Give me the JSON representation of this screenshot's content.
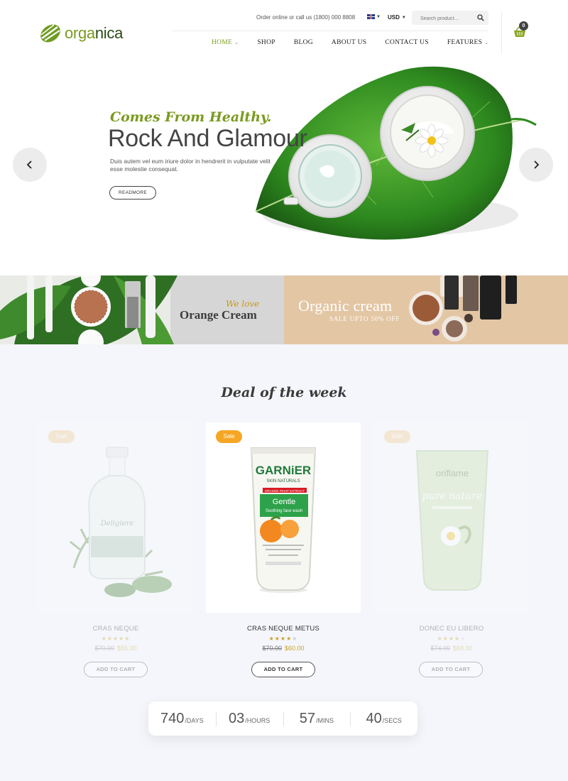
{
  "brand": {
    "logo_part1": "orga",
    "logo_part2": "nica"
  },
  "topbar": {
    "contact": "Order online or call us (1800) 000 8808",
    "currency": "USD",
    "search_placeholder": "Search product..."
  },
  "nav": [
    {
      "label": "HOME",
      "dropdown": true,
      "active": true
    },
    {
      "label": "SHOP",
      "dropdown": false
    },
    {
      "label": "BLOG",
      "dropdown": false
    },
    {
      "label": "ABOUT US",
      "dropdown": false
    },
    {
      "label": "CONTACT US",
      "dropdown": false
    },
    {
      "label": "FEATURES",
      "dropdown": true
    }
  ],
  "cart": {
    "count": "0"
  },
  "hero": {
    "tagline": "Comes From Healthy.",
    "title": "Rock And Glamour",
    "description": "Duis autem vel eum iriure dolor in hendrerit in vulputate velit esse molestie consequat.",
    "button": "READMORE"
  },
  "banners": {
    "left": {
      "small": "We love",
      "title": "Orange Cream"
    },
    "right": {
      "title": "Organic cream",
      "subtitle": "SALE UPTO 50% OFF"
    }
  },
  "deals": {
    "heading": "Deal of the week",
    "products": [
      {
        "badge": "Sale",
        "name": "CRAS NEQUE",
        "rating": 5,
        "old_price": "$70.00",
        "new_price": "$55.00",
        "button": "ADD TO CART"
      },
      {
        "badge": "Sale",
        "name": "CRAS NEQUE METUS",
        "rating": 4,
        "old_price": "$70.00",
        "new_price": "$60.00",
        "button": "ADD TO CART"
      },
      {
        "badge": "Sale",
        "name": "DONEC EU LIBERO",
        "rating": 4,
        "old_price": "$74.00",
        "new_price": "$69.00",
        "button": "ADD TO CART"
      }
    ],
    "product_texts": {
      "garnier_brand": "GARNiER",
      "garnier_line": "SKIN NATURALS",
      "garnier_product": "Gentle",
      "garnier_product_sub": "Soothing face wash",
      "garnier_ribbon": "ORANGE FRUIT EXTRACT",
      "oriflame_brand": "oriflame",
      "oriflame_line": "pure nature",
      "bottle_label": "Deligiere"
    },
    "countdown": [
      {
        "value": "740",
        "label": "/DAYS"
      },
      {
        "value": "03",
        "label": "/HOURS"
      },
      {
        "value": "57",
        "label": "/MINS"
      },
      {
        "value": "40",
        "label": "/SECS"
      }
    ]
  },
  "colors": {
    "accent": "#7a9a1e",
    "sale_badge": "#f5a623",
    "star": "#c9a227"
  }
}
